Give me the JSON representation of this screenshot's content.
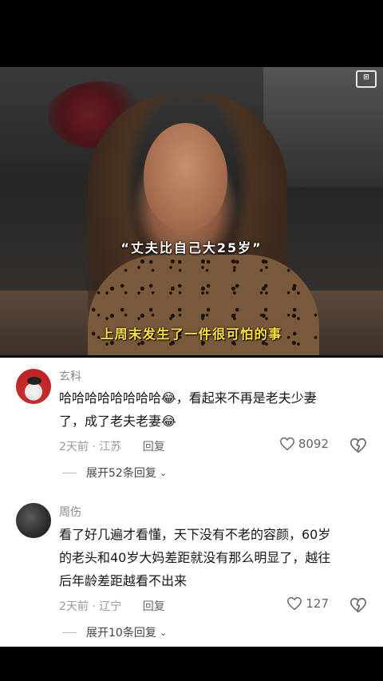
{
  "video": {
    "caption_top": "“丈夫比自己大25岁”",
    "caption_bottom": "上周末发生了一件很可怕的事"
  },
  "comments": [
    {
      "username": "玄科",
      "text_line1": "哈哈哈哈哈哈哈哈😂，看起来不再是老夫少妻",
      "text_line2": "了，成了老夫老妻😂",
      "time": "2天前",
      "location": "江苏",
      "reply_label": "回复",
      "likes": "8092",
      "expand_label": "展开52条回复"
    },
    {
      "username": "周伤",
      "text_line1": "看了好几遍才看懂，天下没有不老的容颜，60岁",
      "text_line2": "的老头和40岁大妈差距就没有那么明显了，越往",
      "text_line3": "后年龄差距越看不出来",
      "time": "2天前",
      "location": "辽宁",
      "reply_label": "回复",
      "likes": "127",
      "expand_label": "展开10条回复"
    }
  ],
  "icons": {
    "heart": "heart-outline-icon",
    "dislike": "broken-heart-icon",
    "chevron": "chevron-down-icon"
  }
}
